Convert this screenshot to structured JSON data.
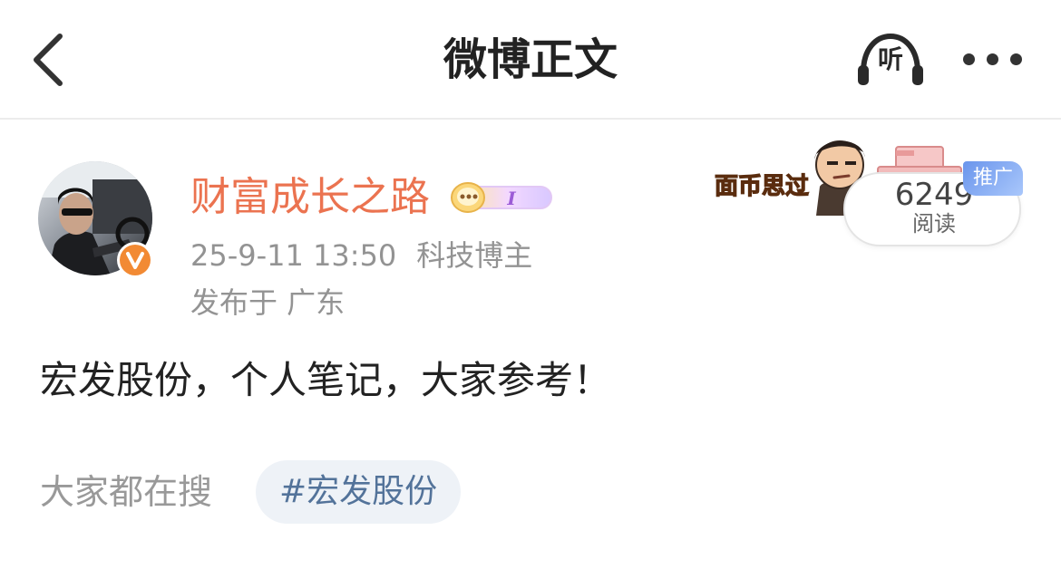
{
  "nav": {
    "title": "微博正文",
    "listen_label": "听",
    "back_icon": "chevron-left-icon",
    "more_icon": "more-dots-icon"
  },
  "author": {
    "name": "财富成长之路",
    "verified_icon": "verified-v-badge",
    "vip_icon": "vip-badge-icon"
  },
  "post": {
    "time": "25-9-11 13:50",
    "tag": "科技博主",
    "location": "发布于 广东",
    "text": "宏发股份，个人笔记，大家参考！"
  },
  "ad": {
    "sticker_text": "面币思过",
    "read_count": "6249",
    "read_label": "阅读",
    "promo_label": "推广"
  },
  "hot_search": {
    "label": "大家都在搜",
    "topic": "#宏发股份"
  },
  "colors": {
    "name_orange": "#eb7350",
    "meta_gray": "#939393",
    "topic_blue": "#53739a",
    "chip_bg": "#eef2f7",
    "promo_blue": "#6a95ec"
  }
}
